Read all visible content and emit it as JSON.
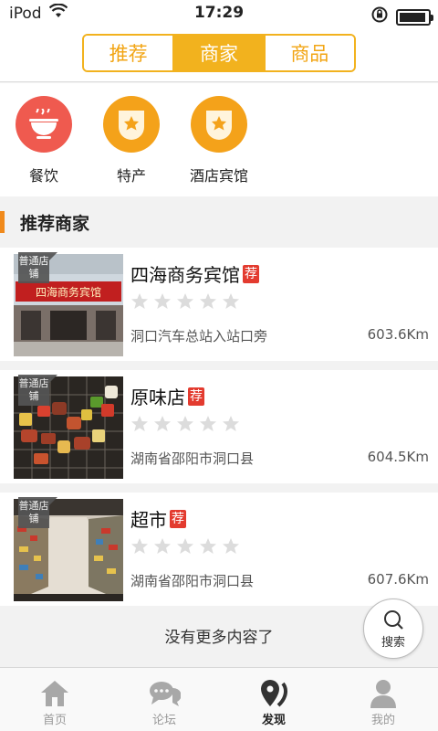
{
  "status_bar": {
    "carrier": "iPod",
    "time": "17:29"
  },
  "top_tabs": [
    {
      "label": "推荐",
      "active": false
    },
    {
      "label": "商家",
      "active": true
    },
    {
      "label": "商品",
      "active": false
    }
  ],
  "categories": [
    {
      "label": "餐饮",
      "icon": "bowl-icon",
      "color": "#ef5a4f"
    },
    {
      "label": "特产",
      "icon": "star-badge-icon",
      "color": "#f4a21a"
    },
    {
      "label": "酒店宾馆",
      "icon": "star-badge-icon",
      "color": "#f4a21a"
    }
  ],
  "section_title": "推荐商家",
  "merchants": [
    {
      "tag": "普通店铺",
      "name": "四海商务宾馆",
      "rec": "荐",
      "rating": 0,
      "address": "洞口汽车总站入站口旁",
      "distance": "603.6Km",
      "sign_text": "四海商务宾馆"
    },
    {
      "tag": "普通店铺",
      "name": "原味店",
      "rec": "荐",
      "rating": 0,
      "address": "湖南省邵阳市洞口县",
      "distance": "604.5Km"
    },
    {
      "tag": "普通店铺",
      "name": "超市",
      "rec": "荐",
      "rating": 0,
      "address": "湖南省邵阳市洞口县",
      "distance": "607.6Km"
    }
  ],
  "no_more": "没有更多内容了",
  "search_button": {
    "label": "搜索"
  },
  "bottom_nav": [
    {
      "label": "首页",
      "icon": "home-icon",
      "active": false
    },
    {
      "label": "论坛",
      "icon": "chat-icon",
      "active": false
    },
    {
      "label": "发现",
      "icon": "discover-icon",
      "active": true
    },
    {
      "label": "我的",
      "icon": "person-icon",
      "active": false
    }
  ],
  "colors": {
    "accent": "#f2b21e",
    "section_bar": "#f08a1c",
    "rec_badge": "#e33b2f",
    "food_red": "#ef5a4f",
    "orange": "#f4a21a"
  }
}
